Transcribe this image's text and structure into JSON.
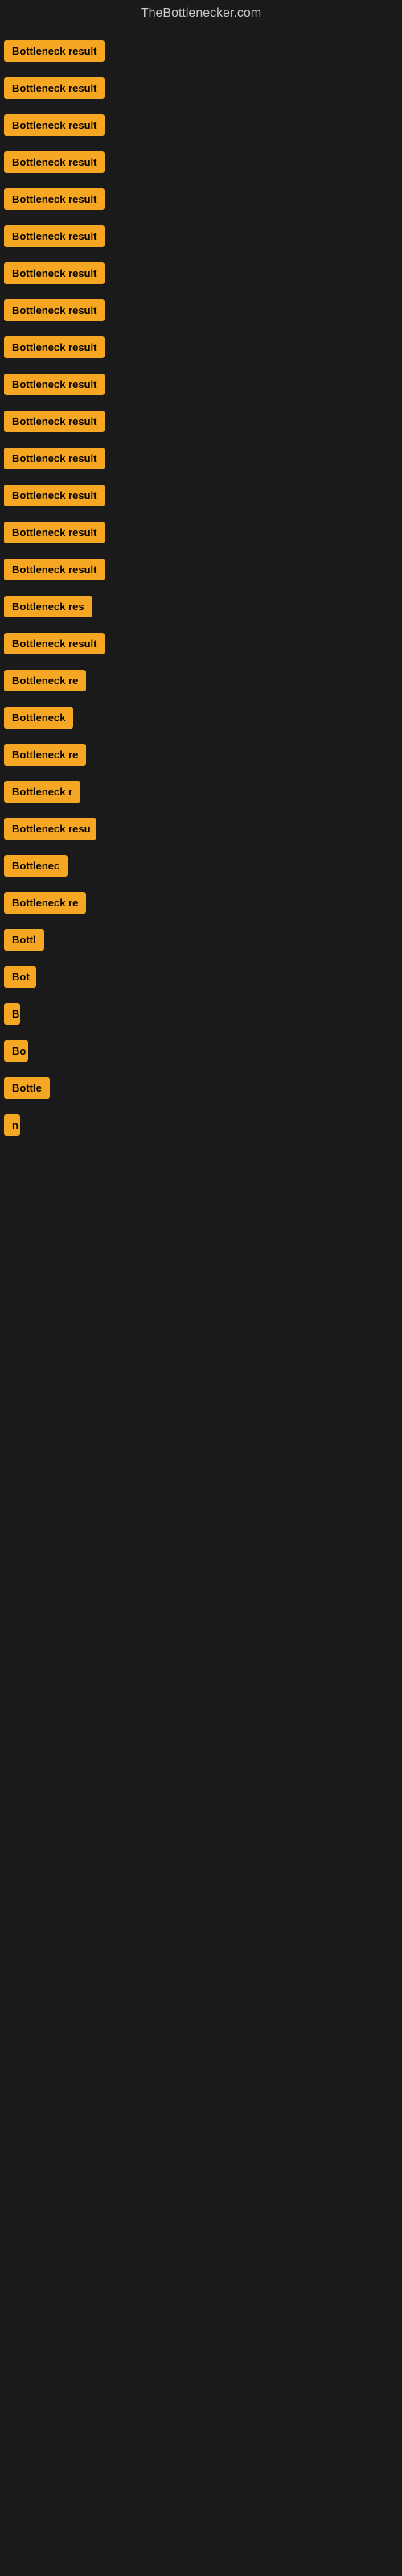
{
  "site": {
    "title": "TheBottlenecker.com"
  },
  "results": [
    {
      "id": 1,
      "label": "Bottleneck result",
      "width": 140
    },
    {
      "id": 2,
      "label": "Bottleneck result",
      "width": 140
    },
    {
      "id": 3,
      "label": "Bottleneck result",
      "width": 140
    },
    {
      "id": 4,
      "label": "Bottleneck result",
      "width": 135
    },
    {
      "id": 5,
      "label": "Bottleneck result",
      "width": 140
    },
    {
      "id": 6,
      "label": "Bottleneck result",
      "width": 135
    },
    {
      "id": 7,
      "label": "Bottleneck result",
      "width": 140
    },
    {
      "id": 8,
      "label": "Bottleneck result",
      "width": 135
    },
    {
      "id": 9,
      "label": "Bottleneck result",
      "width": 140
    },
    {
      "id": 10,
      "label": "Bottleneck result",
      "width": 130
    },
    {
      "id": 11,
      "label": "Bottleneck result",
      "width": 140
    },
    {
      "id": 12,
      "label": "Bottleneck result",
      "width": 128
    },
    {
      "id": 13,
      "label": "Bottleneck result",
      "width": 140
    },
    {
      "id": 14,
      "label": "Bottleneck result",
      "width": 132
    },
    {
      "id": 15,
      "label": "Bottleneck result",
      "width": 135
    },
    {
      "id": 16,
      "label": "Bottleneck res",
      "width": 115
    },
    {
      "id": 17,
      "label": "Bottleneck result",
      "width": 130
    },
    {
      "id": 18,
      "label": "Bottleneck re",
      "width": 108
    },
    {
      "id": 19,
      "label": "Bottleneck",
      "width": 90
    },
    {
      "id": 20,
      "label": "Bottleneck re",
      "width": 108
    },
    {
      "id": 21,
      "label": "Bottleneck r",
      "width": 100
    },
    {
      "id": 22,
      "label": "Bottleneck resu",
      "width": 115
    },
    {
      "id": 23,
      "label": "Bottlenec",
      "width": 85
    },
    {
      "id": 24,
      "label": "Bottleneck re",
      "width": 108
    },
    {
      "id": 25,
      "label": "Bottl",
      "width": 55
    },
    {
      "id": 26,
      "label": "Bot",
      "width": 40
    },
    {
      "id": 27,
      "label": "B",
      "width": 20
    },
    {
      "id": 28,
      "label": "Bo",
      "width": 30
    },
    {
      "id": 29,
      "label": "Bottle",
      "width": 58
    },
    {
      "id": 30,
      "label": "n",
      "width": 14
    }
  ]
}
